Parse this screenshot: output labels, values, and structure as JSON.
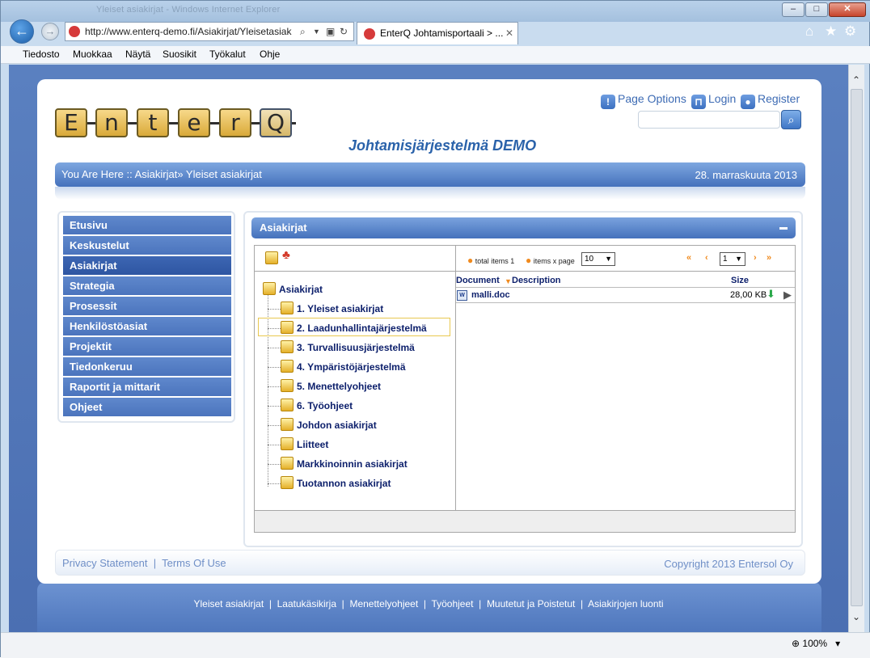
{
  "browser": {
    "window_title": "Yleiset asiakirjat - Windows Internet Explorer",
    "url": "http://www.enterq-demo.fi/Asiakirjat/Yleisetasiak",
    "tab_title": "EnterQ Johtamisportaali > ...",
    "menu": [
      "Tiedosto",
      "Muokkaa",
      "Näytä",
      "Suosikit",
      "Työkalut",
      "Ohje"
    ],
    "zoom": "100%"
  },
  "header": {
    "logo_letters": [
      "E",
      "n",
      "t",
      "e",
      "r",
      "Q"
    ],
    "subtitle": "Johtamisjärjestelmä DEMO",
    "page_options": "Page Options",
    "login": "Login",
    "register": "Register"
  },
  "breadcrumb": {
    "text": "You Are Here :: Asiakirjat» Yleiset asiakirjat",
    "date": "28. marraskuuta 2013"
  },
  "sidebar": {
    "items": [
      {
        "label": "Etusivu"
      },
      {
        "label": "Keskustelut"
      },
      {
        "label": "Asiakirjat"
      },
      {
        "label": "Strategia"
      },
      {
        "label": "Prosessit"
      },
      {
        "label": "Henkilöstöasiat"
      },
      {
        "label": "Projektit"
      },
      {
        "label": "Tiedonkeruu"
      },
      {
        "label": "Raportit ja mittarit"
      },
      {
        "label": "Ohjeet"
      }
    ]
  },
  "panel": {
    "title": "Asiakirjat",
    "tree": {
      "root": "Asiakirjat",
      "children": [
        "1. Yleiset asiakirjat",
        "2. Laadunhallintajärjestelmä",
        "3. Turvallisuusjärjestelmä",
        "4. Ympäristöjärjestelmä",
        "5. Menettelyohjeet",
        "6. Työohjeet",
        "Johdon asiakirjat",
        "Liitteet",
        "Markkinoinnin asiakirjat",
        "Tuotannon asiakirjat"
      ]
    },
    "pager": {
      "total_label": "total items",
      "total_value": "1",
      "items_per_page_label": "items x page",
      "items_per_page_value": "10",
      "page_value": "1"
    },
    "grid": {
      "col_document": "Document",
      "col_description": "Description",
      "col_size": "Size",
      "rows": [
        {
          "document": "malli.doc",
          "size": "28,00 KB"
        }
      ]
    }
  },
  "footer": {
    "privacy": "Privacy Statement",
    "separator": "|",
    "terms": "Terms Of Use",
    "copyright": "Copyright 2013 Entersol Oy",
    "links": [
      "Yleiset asiakirjat",
      "Laatukäsikirja",
      "Menettelyohjeet",
      "Työohjeet",
      "Muutetut ja Poistetut",
      "Asiakirjojen luonti"
    ]
  }
}
